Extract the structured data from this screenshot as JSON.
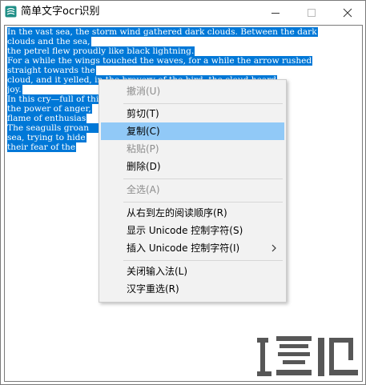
{
  "window": {
    "title": "简单文字ocr识别",
    "icons": {
      "app": "app-logo-icon",
      "minimize": "minimize-icon",
      "maximize": "maximize-icon",
      "close": "close-icon"
    }
  },
  "text": {
    "lines": [
      "In the vast sea, the storm wind gathered dark clouds. Between the dark",
      "clouds and the sea,",
      " the petrel flew proudly like black lightning.",
      " For a while the wings touched the waves, for a while the arrow rushed",
      "straight towards the",
      " cloud, and it yelled, in the bravery of the bird, the cloud heard",
      "joy.",
      " In this cry—full of thirst for the storm! Wu Yun heard",
      "the power of anger,",
      "flame of enthusias",
      "The seagulls groan                                    flew over the",
      "sea, trying to hide",
      " their fear of the"
    ],
    "selection_color": "#0078d7"
  },
  "context_menu": {
    "hover_color": "#91c9f7",
    "items": [
      {
        "label": "撤消(U)",
        "enabled": false
      },
      {
        "label": "剪切(T)",
        "enabled": true
      },
      {
        "label": "复制(C)",
        "enabled": true,
        "highlighted": true
      },
      {
        "label": "粘贴(P)",
        "enabled": false
      },
      {
        "label": "删除(D)",
        "enabled": true
      },
      {
        "label": "全选(A)",
        "enabled": false
      },
      {
        "label": "从右到左的阅读顺序(R)",
        "enabled": true
      },
      {
        "label": "显示 Unicode 控制字符(S)",
        "enabled": true
      },
      {
        "label": "插入 Unicode 控制字符(I)",
        "enabled": true,
        "has_submenu": true
      },
      {
        "label": "关闭输入法(L)",
        "enabled": true
      },
      {
        "label": "汉字重选(R)",
        "enabled": true
      }
    ]
  },
  "watermark": {
    "icon": "site-watermark-logo-icon"
  }
}
